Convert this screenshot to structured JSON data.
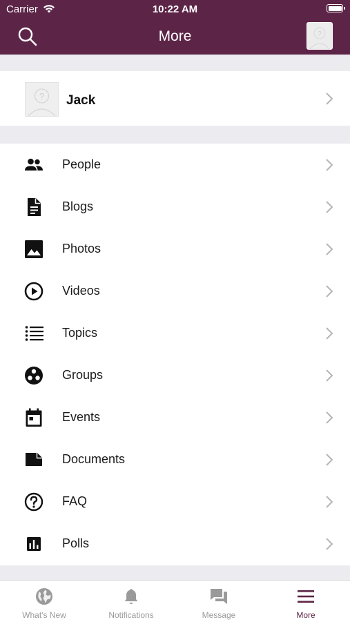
{
  "status_bar": {
    "carrier": "Carrier",
    "time": "10:22 AM"
  },
  "header": {
    "title": "More"
  },
  "profile": {
    "name": "Jack"
  },
  "menu": {
    "items": [
      {
        "label": "People",
        "icon": "people-icon"
      },
      {
        "label": "Blogs",
        "icon": "document-icon"
      },
      {
        "label": "Photos",
        "icon": "photo-icon"
      },
      {
        "label": "Videos",
        "icon": "play-circle-icon"
      },
      {
        "label": "Topics",
        "icon": "list-icon"
      },
      {
        "label": "Groups",
        "icon": "groups-icon"
      },
      {
        "label": "Events",
        "icon": "calendar-icon"
      },
      {
        "label": "Documents",
        "icon": "file-icon"
      },
      {
        "label": "FAQ",
        "icon": "question-circle-icon"
      },
      {
        "label": "Polls",
        "icon": "bar-chart-icon"
      }
    ]
  },
  "tabbar": {
    "tabs": [
      {
        "label": "What's New",
        "icon": "globe-icon",
        "active": false
      },
      {
        "label": "Notifications",
        "icon": "bell-icon",
        "active": false
      },
      {
        "label": "Message",
        "icon": "chat-icon",
        "active": false
      },
      {
        "label": "More",
        "icon": "menu-icon",
        "active": true
      }
    ]
  },
  "colors": {
    "brand": "#5c2447",
    "inactive_tab": "#9a9a9a",
    "background": "#ececf0"
  }
}
